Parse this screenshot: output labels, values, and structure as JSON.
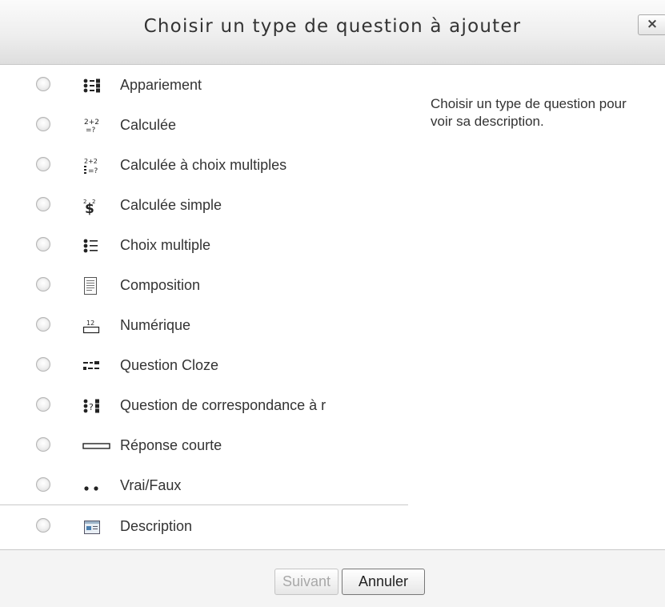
{
  "dialog": {
    "title": "Choisir un type de question à ajouter",
    "close_label": "×"
  },
  "options": [
    {
      "label": "Appariement",
      "icon": "matching-icon"
    },
    {
      "label": "Calculée",
      "icon": "calculated-icon"
    },
    {
      "label": "Calculée à choix multiples",
      "icon": "calculated-multichoice-icon"
    },
    {
      "label": "Calculée simple",
      "icon": "calculated-simple-icon"
    },
    {
      "label": "Choix multiple",
      "icon": "multichoice-icon"
    },
    {
      "label": "Composition",
      "icon": "essay-icon"
    },
    {
      "label": "Numérique",
      "icon": "numerical-icon"
    },
    {
      "label": "Question Cloze",
      "icon": "cloze-icon"
    },
    {
      "label": "Question de correspondance à r",
      "icon": "random-short-answer-matching-icon"
    },
    {
      "label": "Réponse courte",
      "icon": "short-answer-icon"
    },
    {
      "label": "Vrai/Faux",
      "icon": "true-false-icon"
    },
    {
      "label": "Description",
      "icon": "description-icon"
    }
  ],
  "description_panel": {
    "text": "Choisir un type de question pour voir sa description."
  },
  "footer": {
    "next_label": "Suivant",
    "cancel_label": "Annuler"
  }
}
